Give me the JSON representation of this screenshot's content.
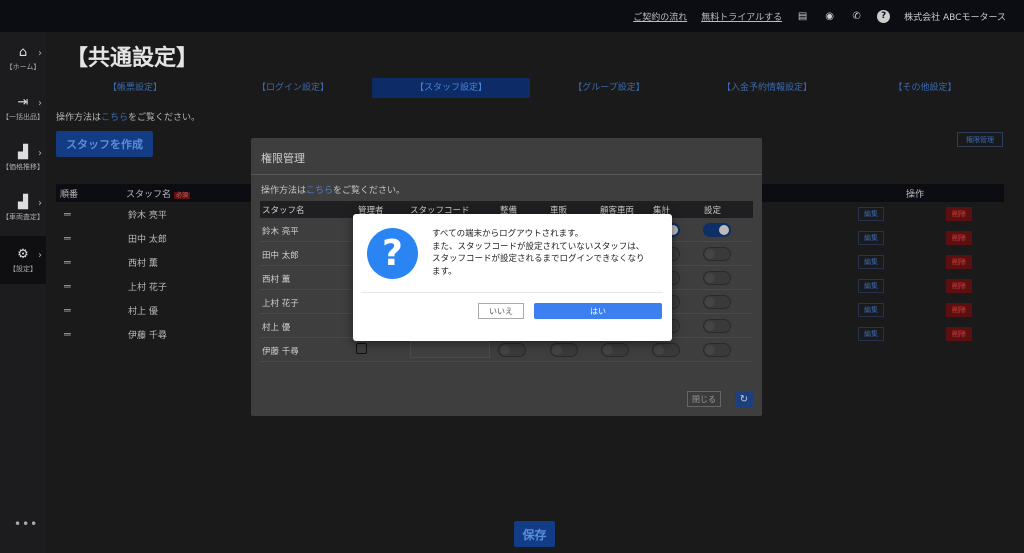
{
  "topbar": {
    "links": [
      "ご契約の流れ",
      "無料トライアルする"
    ],
    "icons": [
      "document-icon",
      "chat-icon",
      "phone-icon",
      "help-icon"
    ],
    "company": "株式会社 ABCモータース"
  },
  "sidebar": {
    "items": [
      {
        "icon": "home-icon",
        "label": "【ホーム】"
      },
      {
        "icon": "export-icon",
        "label": "【一括出品】"
      },
      {
        "icon": "chart-icon",
        "label": "【価格推移】"
      },
      {
        "icon": "chart-icon",
        "label": "【車両査定】"
      },
      {
        "icon": "gear-icon",
        "label": "【設定】"
      }
    ],
    "more": "•••"
  },
  "page": {
    "title": "【共通設定】",
    "tabs": [
      "【帳票設定】",
      "【ログイン設定】",
      "【スタッフ設定】",
      "【グループ設定】",
      "【入金予約情報設定】",
      "【その他設定】"
    ],
    "instruction_prefix": "操作方法は",
    "instruction_link": "こちら",
    "instruction_suffix": "をご覧ください。",
    "create_button": "スタッフを作成",
    "permission_button": "権限管理",
    "save_button": "保存"
  },
  "bg_table": {
    "headers": {
      "order": "順番",
      "name": "スタッフ名",
      "required": "必須",
      "actions": "操作"
    },
    "edit_label": "編集",
    "delete_label": "削除",
    "rows": [
      "鈴木 亮平",
      "田中 太郎",
      "西村 薫",
      "上村 花子",
      "村上 優",
      "伊藤 千尋"
    ]
  },
  "permission_modal": {
    "title": "権限管理",
    "instruction_prefix": "操作方法は",
    "instruction_link": "こちら",
    "instruction_suffix": "をご覧ください。",
    "columns": [
      "スタッフ名",
      "管理者",
      "スタッフコード",
      "整備",
      "車販",
      "顧客車両",
      "集計",
      "設定"
    ],
    "rows": [
      "鈴木 亮平",
      "田中 太郎",
      "西村 薫",
      "上村 花子",
      "村上 優",
      "伊藤 千尋"
    ],
    "close_button": "閉じる"
  },
  "confirm_dialog": {
    "message_lines": [
      "すべての端末からログアウトされます。",
      "また、スタッフコードが設定されていないスタッフは、",
      "スタッフコードが設定されるまでログインできなくなり",
      "ます。"
    ],
    "no_button": "いいえ",
    "yes_button": "はい"
  },
  "colors": {
    "accent": "#2a85f3",
    "yes_button": "#3b7ff0",
    "delete": "#5c0f0f"
  }
}
